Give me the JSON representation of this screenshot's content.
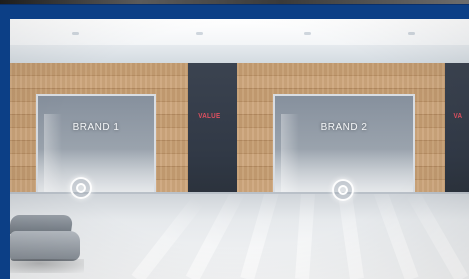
{
  "scene": {
    "brand_mark_left": "VALUE",
    "brand_mark_right": "VA",
    "booths": [
      {
        "label": "BRAND 1"
      },
      {
        "label": "BRAND 2"
      }
    ]
  },
  "colors": {
    "frame_blue": "#0c3f86",
    "wood": "#c59d72",
    "dark_panel": "#313946",
    "brand_red": "#e05060"
  },
  "icons": {
    "hotspot": "target-ring-icon",
    "sofa": "sofa-icon"
  }
}
